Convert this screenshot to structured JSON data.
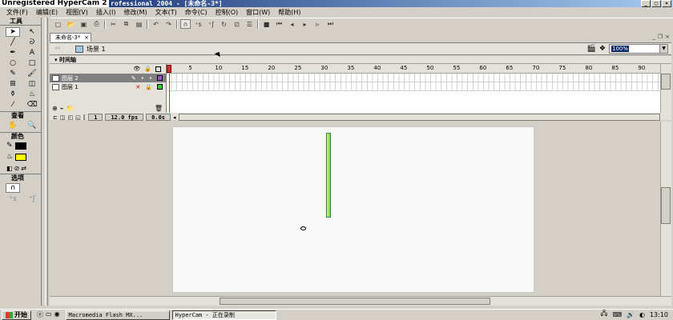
{
  "titlebar": {
    "overlay": "Unregistered HyperCam 2",
    "title": "rofessional 2004 - [未命名-3*]"
  },
  "menu": [
    "文件(F)",
    "编辑(E)",
    "视图(V)",
    "插入(I)",
    "修改(M)",
    "文本(T)",
    "命令(C)",
    "控制(O)",
    "窗口(W)",
    "帮助(H)"
  ],
  "tools": {
    "header": "工具",
    "view_header": "查看",
    "color_header": "颜色",
    "options_header": "选项",
    "fill_color": "#ffff00",
    "stroke_color": "#000000"
  },
  "document": {
    "tab": "未命名-3*",
    "scene": "场景 1",
    "zoom": "100%"
  },
  "timeline": {
    "header": "时间轴",
    "layers": [
      {
        "name": "图层 2",
        "selected": true,
        "color": "#9a57cc"
      },
      {
        "name": "图层 1",
        "selected": false,
        "color": "#33cc33"
      }
    ],
    "ruler_ticks": [
      "1",
      "5",
      "10",
      "15",
      "20",
      "25",
      "30",
      "35",
      "40",
      "45",
      "50",
      "55",
      "60",
      "65",
      "70",
      "75",
      "80",
      "85",
      "90"
    ],
    "frame": "1",
    "fps": "12.0 fps",
    "time": "0.0s"
  },
  "taskbar": {
    "start": "开始",
    "items": [
      "Macromedia Flash MX...",
      "HyperCam - 正在录制"
    ],
    "clock": "13:10"
  }
}
